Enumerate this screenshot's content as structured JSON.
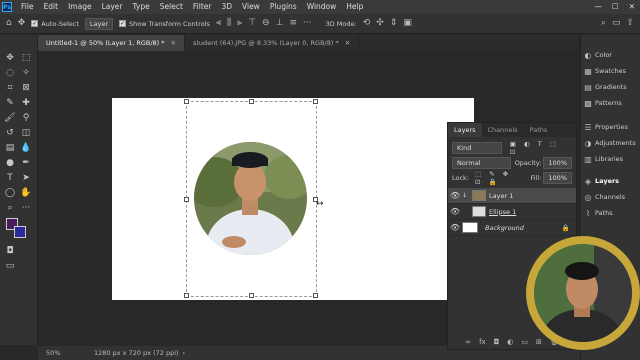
{
  "menubar": {
    "logo": "Ps",
    "items": [
      "File",
      "Edit",
      "Image",
      "Layer",
      "Type",
      "Select",
      "Filter",
      "3D",
      "View",
      "Plugins",
      "Window",
      "Help"
    ]
  },
  "options": {
    "auto_select_label": "Auto-Select",
    "auto_select_target": "Layer",
    "transform_label": "Show Transform Controls",
    "mode_label": "3D Mode:"
  },
  "tabs": [
    {
      "label": "Untitled-1 @ 50% (Layer 1, RGB/8) *",
      "active": true
    },
    {
      "label": "student (64).JPG @ 8.33% (Layer 0, RGB/8) *",
      "active": false
    }
  ],
  "status": {
    "zoom": "50%",
    "dimensions": "1280 px x 720 px (72 ppi)"
  },
  "layers_panel": {
    "tabs": [
      "Layers",
      "Channels",
      "Paths"
    ],
    "filter_kind": "Kind",
    "blend_mode": "Normal",
    "opacity_label": "Opacity:",
    "opacity_value": "100%",
    "lock_label": "Lock:",
    "fill_label": "Fill:",
    "fill_value": "100%",
    "layers": [
      {
        "name": "Layer 1",
        "selected": true
      },
      {
        "name": "Ellipse 1",
        "selected": false
      },
      {
        "name": "Background",
        "selected": false
      }
    ]
  },
  "right_dock": {
    "items": [
      "Color",
      "Swatches",
      "Gradients",
      "Patterns",
      "Properties",
      "Adjustments",
      "Libraries",
      "Layers",
      "Channels",
      "Paths"
    ]
  }
}
